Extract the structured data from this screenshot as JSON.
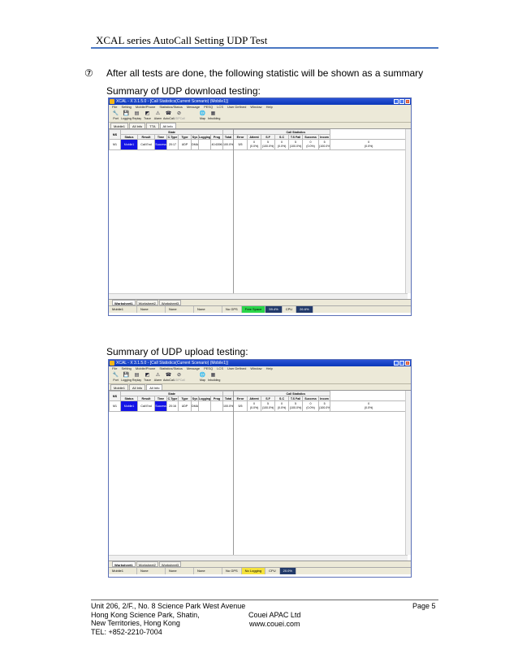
{
  "header": {
    "title": "XCAL series AutoCall Setting UDP Test"
  },
  "step": {
    "marker": "⑦",
    "text": "After all tests are done, the following statistic will be shown as a summary"
  },
  "sections": [
    {
      "label": "Summary of UDP download testing:",
      "app": {
        "title": "XCAL - X 3.1.5.0 - [Call Statistics(Current Scenario) (Mobile1)]",
        "window_buttons": [
          "_",
          "□",
          "×"
        ],
        "menu": [
          "File",
          "Setting",
          "Mobile/Phone",
          "Statistics/Status",
          "Message",
          "PESQ",
          "LCS",
          "User Defined",
          "Window",
          "Help"
        ],
        "toolbar": [
          {
            "label": "Port",
            "icon": "wrench-icon",
            "glyph": "🔧",
            "enabled": true
          },
          {
            "label": "Logging",
            "icon": "floppy-icon",
            "glyph": "💾",
            "enabled": true
          },
          {
            "label": "Replay",
            "icon": "replay-icon",
            "glyph": "▤",
            "enabled": true
          },
          {
            "label": "Trace",
            "icon": "trace-icon",
            "glyph": "◩",
            "enabled": true
          },
          {
            "label": "Alarm",
            "icon": "alarm-icon",
            "glyph": "⚠",
            "enabled": true
          },
          {
            "label": "AutoCall",
            "icon": "autocall-icon",
            "glyph": "☎",
            "enabled": true
          },
          {
            "label": "UDPCall",
            "icon": "udpcall-icon",
            "glyph": "⊘",
            "enabled": false
          },
          {
            "label": "Map",
            "icon": "map-icon",
            "glyph": "🌐",
            "enabled": true
          },
          {
            "label": "Inbuilding",
            "icon": "inbuilding-icon",
            "glyph": "▦",
            "enabled": true
          }
        ],
        "tabs": [
          "Mobile1",
          "All Info",
          "TTA",
          "All Info"
        ],
        "table": {
          "group_headers": [
            "MS",
            "State",
            "Call Statistics"
          ],
          "columns": [
            "Status",
            "Result",
            "Time",
            "C.Type",
            "Type",
            "Sys",
            "Logging",
            "Prog",
            "Total",
            "Error",
            "Attemt",
            "S.F",
            "S.C",
            "T.S Fail",
            "Success",
            "Incom"
          ],
          "row": {
            "ms": "M1",
            "status": "Mobile1",
            "result": "Call End",
            "result2": "Success",
            "time": "20:17",
            "ctype": "UDP",
            "type": "DMA - UDP I",
            "sys": "",
            "logging": "40.6396",
            "prog": "100.0%",
            "total": "5/5",
            "error": [
              "0",
              "(0.0%)"
            ],
            "attemt": [
              "5",
              "(100.0%)"
            ],
            "sf": [
              "0",
              "(0.0%)"
            ],
            "sc": [
              "5",
              "(100.0%)"
            ],
            "tsfail": [
              "0",
              "(0.0%)"
            ],
            "success": [
              "5",
              "(100.0%)"
            ],
            "incom": [
              "0",
              "(0.0%)"
            ]
          }
        },
        "sheets": [
          "Worksheet1",
          "Worksheet2",
          "Worksheet3"
        ],
        "status": [
          "Mobile1",
          "None",
          "None",
          "None",
          "No GPS",
          "Free Space",
          "59.4%",
          "CPU",
          "26.6%"
        ]
      }
    },
    {
      "label": "Summary of UDP upload testing:",
      "app": {
        "title": "XCAL - X 3.1.5.0 - [Call Statistics(Current Scenario) (Mobile1)]",
        "window_buttons": [
          "_",
          "□",
          "×"
        ],
        "menu": [
          "File",
          "Setting",
          "Mobile/Phone",
          "Statistics/Status",
          "Message",
          "PESQ",
          "LCS",
          "User Defined",
          "Window",
          "Help"
        ],
        "toolbar": [
          {
            "label": "Port",
            "icon": "wrench-icon",
            "glyph": "🔧",
            "enabled": true
          },
          {
            "label": "Logging",
            "icon": "floppy-icon",
            "glyph": "💾",
            "enabled": true
          },
          {
            "label": "Replay",
            "icon": "replay-icon",
            "glyph": "▤",
            "enabled": true
          },
          {
            "label": "Trace",
            "icon": "trace-icon",
            "glyph": "◩",
            "enabled": true
          },
          {
            "label": "Alarm",
            "icon": "alarm-icon",
            "glyph": "⚠",
            "enabled": true
          },
          {
            "label": "AutoCall",
            "icon": "autocall-icon",
            "glyph": "☎",
            "enabled": true
          },
          {
            "label": "UDPCall",
            "icon": "udpcall-icon",
            "glyph": "⊘",
            "enabled": false
          },
          {
            "label": "Map",
            "icon": "map-icon",
            "glyph": "🌐",
            "enabled": true
          },
          {
            "label": "Inbuilding",
            "icon": "inbuilding-icon",
            "glyph": "▦",
            "enabled": true
          }
        ],
        "tabs": [
          "Mobile1",
          "All Info",
          "All Info"
        ],
        "table": {
          "group_headers": [
            "MS",
            "State",
            "Call Statistics"
          ],
          "columns": [
            "Status",
            "Result",
            "Time",
            "C.Type",
            "Type",
            "Sys",
            "Logging",
            "Prog",
            "Total",
            "Error",
            "Attemt",
            "S.F",
            "S.C",
            "T.S Fail",
            "Success",
            "Incom"
          ],
          "row": {
            "ms": "M1",
            "status": "Mobile1",
            "result": "Call End",
            "result2": "Success",
            "time": "20:16",
            "ctype": "UDP",
            "type": "DMA - UDP",
            "sys": "",
            "logging": "",
            "prog": "100.0%",
            "total": "5/5",
            "error": [
              "0",
              "(0.0%)"
            ],
            "attemt": [
              "5",
              "(100.0%)"
            ],
            "sf": [
              "0",
              "(0.0%)"
            ],
            "sc": [
              "5",
              "(100.0%)"
            ],
            "tsfail": [
              "0",
              "(0.0%)"
            ],
            "success": [
              "5",
              "(100.0%)"
            ],
            "incom": [
              "0",
              "(0.0%)"
            ]
          }
        },
        "sheets": [
          "Worksheet1",
          "Worksheet2",
          "Worksheet3"
        ],
        "status": [
          "Mobile1",
          "None",
          "None",
          "None",
          "No GPS",
          "No Logging",
          "CPU",
          "20.0%"
        ]
      }
    }
  ],
  "footer": {
    "left": [
      "Unit 206, 2/F., No. 8 Science Park West Avenue",
      "Hong Kong Science Park, Shatin,",
      "New Territories, Hong Kong",
      "TEL: +852-2210-7004"
    ],
    "center": [
      "Couei APAC Ltd",
      "www.couei.com"
    ],
    "page": "Page 5"
  }
}
